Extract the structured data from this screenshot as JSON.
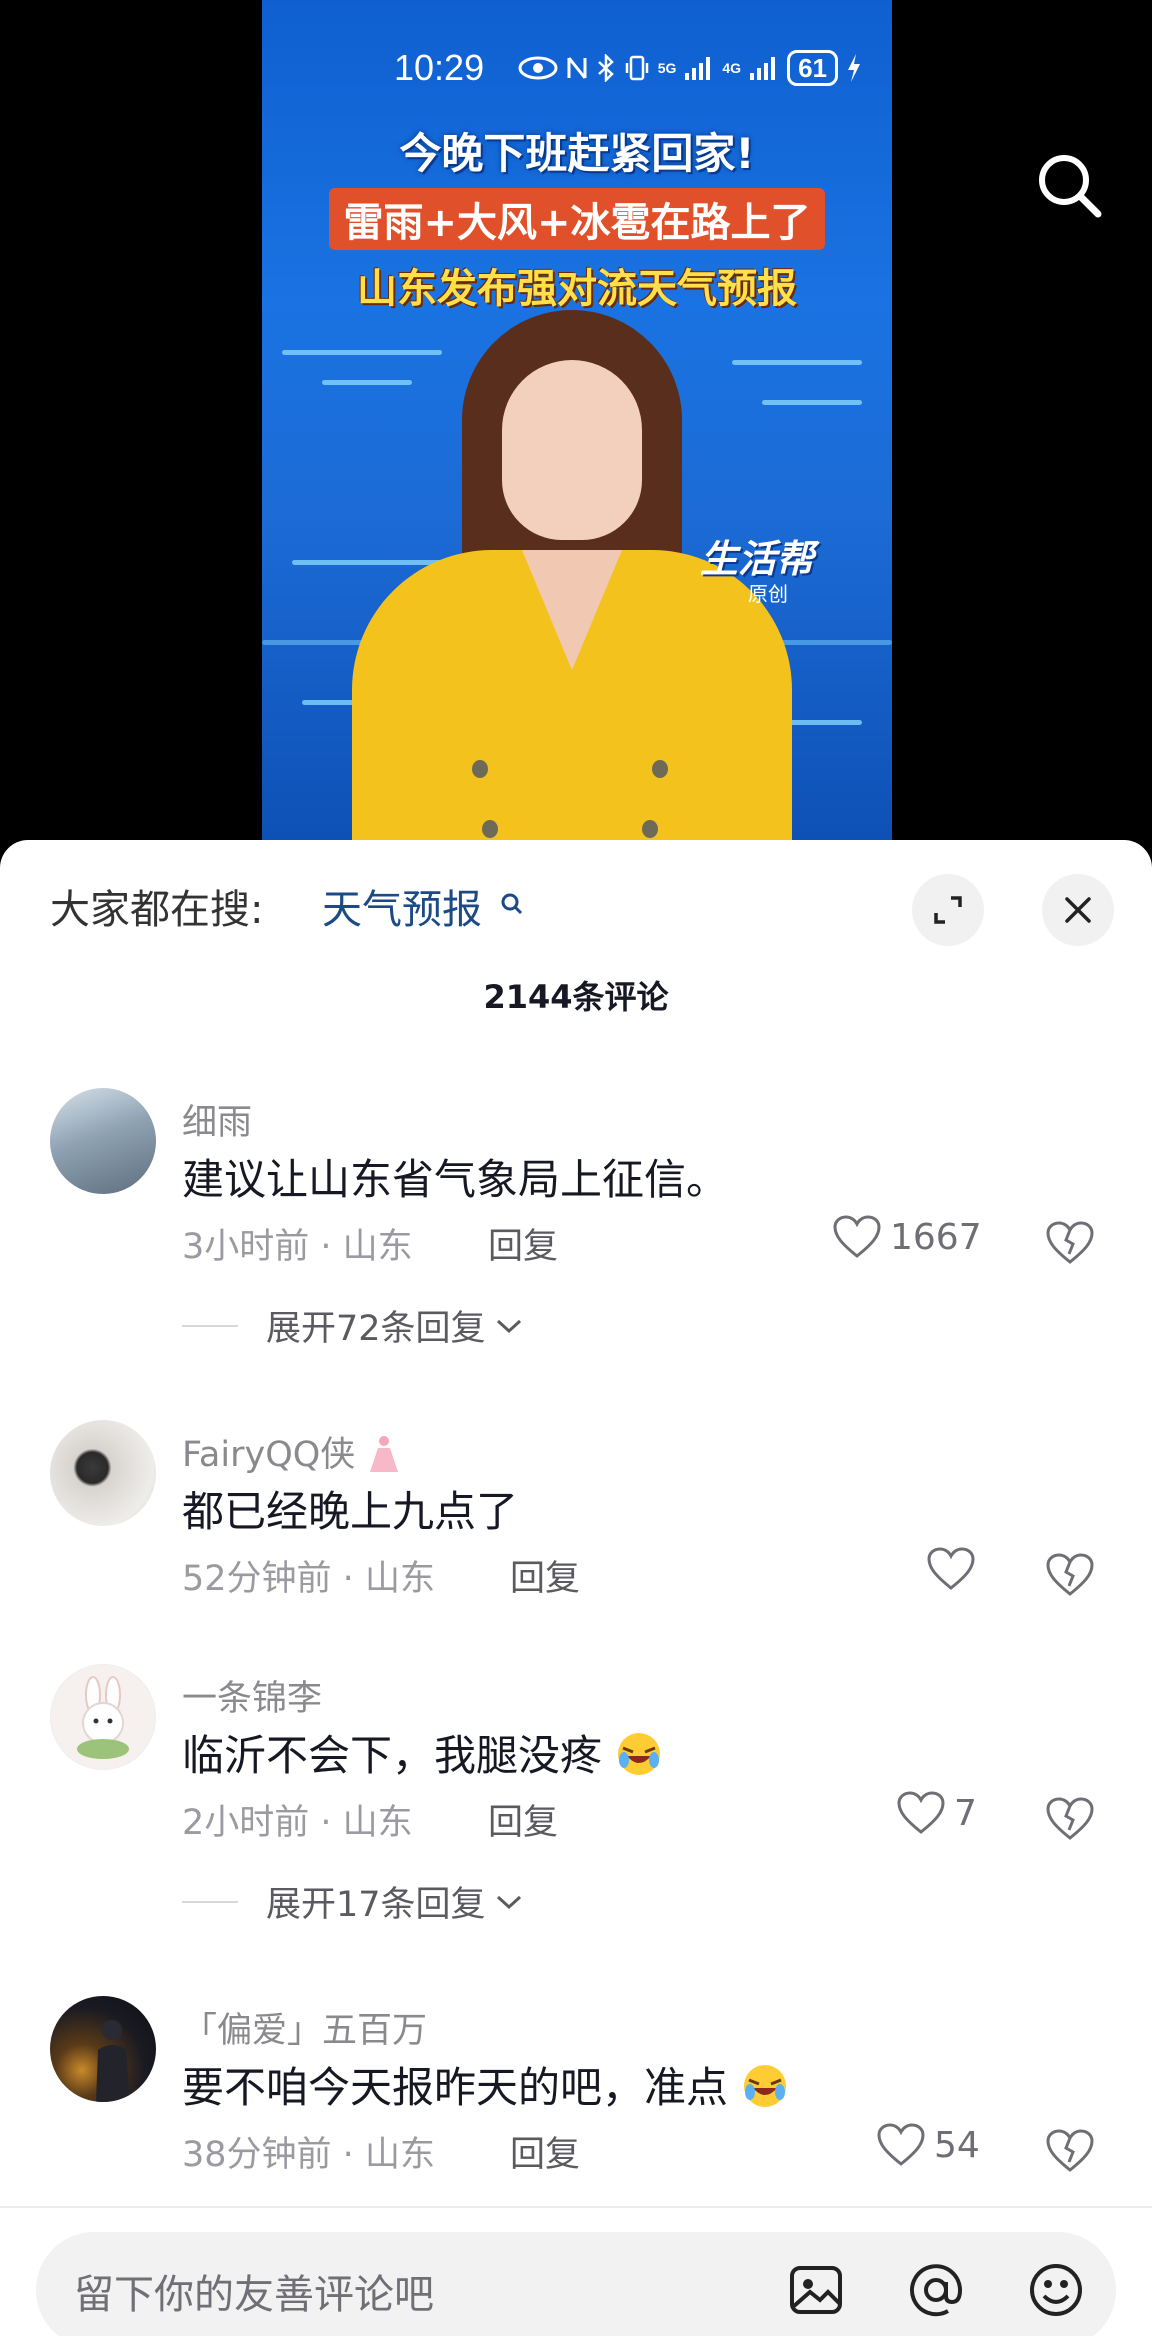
{
  "status_bar": {
    "time": "10:29",
    "network": "5G",
    "network2": "4G",
    "battery": "61"
  },
  "video": {
    "headline_1": "今晚下班赶紧回家!",
    "headline_2": "雷雨+大风+冰雹在路上了",
    "headline_3": "山东发布强对流天气预报",
    "logo": "生活帮",
    "logo_sub": "原创"
  },
  "sheet": {
    "search_prefix": "大家都在搜:",
    "search_term": "天气预报",
    "comment_count": "2144条评论"
  },
  "comments": [
    {
      "username": "细雨",
      "content": "建议让山东省气象局上征信。",
      "time": "3小时前",
      "location": "山东",
      "reply": "回复",
      "likes": "1667",
      "expand": "展开72条回复"
    },
    {
      "username": "FairyQQ侠",
      "content": "都已经晚上九点了",
      "time": "52分钟前",
      "location": "山东",
      "reply": "回复",
      "likes": ""
    },
    {
      "username": "一条锦李",
      "content": "临沂不会下，我腿没疼",
      "time": "2小时前",
      "location": "山东",
      "reply": "回复",
      "likes": "7",
      "expand": "展开17条回复"
    },
    {
      "username": "「偏爱」五百万",
      "content": "要不咱今天报昨天的吧，准点",
      "time": "38分钟前",
      "location": "山东",
      "reply": "回复",
      "likes": "54"
    }
  ],
  "input": {
    "placeholder": "留下你的友善评论吧"
  },
  "colors": {
    "accent_link": "#1c4a85",
    "video_bg": "#1a73e2",
    "jacket": "#f4c21d"
  }
}
